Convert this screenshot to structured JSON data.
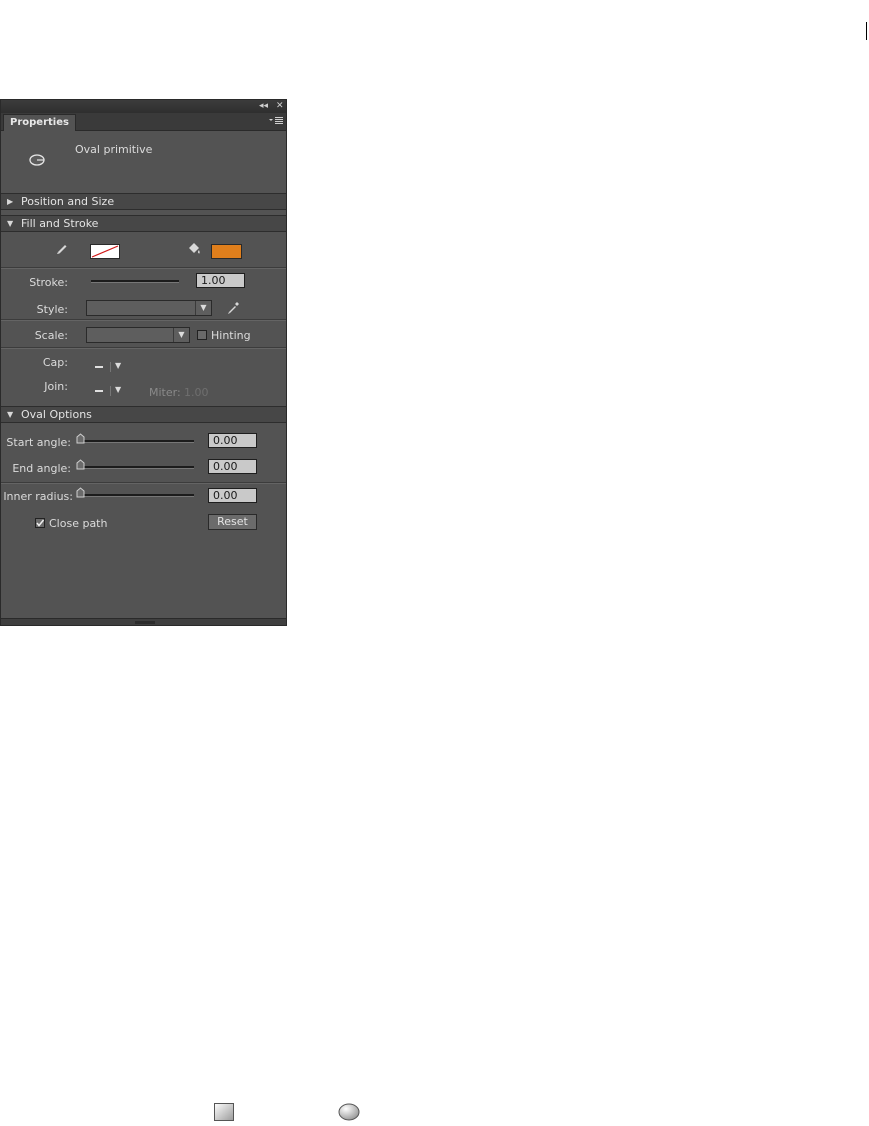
{
  "panel": {
    "title_controls": {
      "collapse": "◂◂",
      "close": "✕"
    },
    "tab_label": "Properties",
    "object_type": "Oval primitive"
  },
  "sections": {
    "position_size": "Position and Size",
    "fill_stroke": "Fill and Stroke",
    "oval_options": "Oval Options"
  },
  "fill_stroke": {
    "stroke_label": "Stroke:",
    "stroke_value": "1.00",
    "style_label": "Style:",
    "scale_label": "Scale:",
    "hinting_label": "Hinting",
    "hinting_checked": false,
    "cap_label": "Cap:",
    "join_label": "Join:",
    "miter_label": "Miter:",
    "miter_value": "1.00",
    "fill_color": "#e07f1c",
    "stroke_color": "none"
  },
  "oval_options": {
    "start_angle_label": "Start angle:",
    "start_angle_value": "0.00",
    "end_angle_label": "End angle:",
    "end_angle_value": "0.00",
    "inner_radius_label": "Inner radius:",
    "inner_radius_value": "0.00",
    "close_path_label": "Close path",
    "close_path_checked": true,
    "reset_label": "Reset"
  },
  "icons": [
    "oval-primitive-icon",
    "pencil-icon",
    "paint-bucket-icon",
    "eyedropper-icon",
    "rectangle-primitive-icon",
    "oval-primitive-icon"
  ]
}
